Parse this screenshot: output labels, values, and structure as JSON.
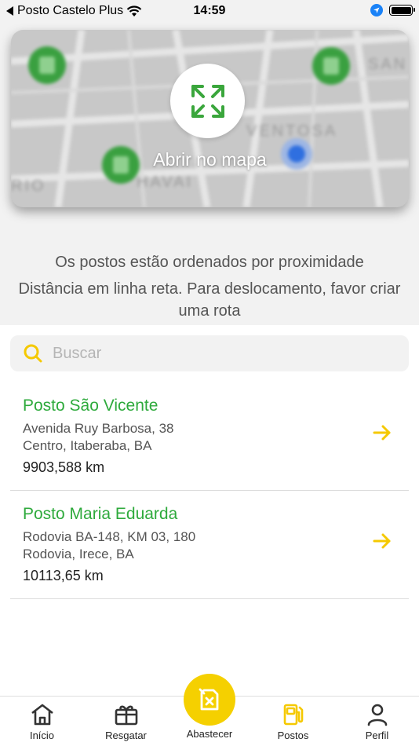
{
  "status_bar": {
    "carrier": "Posto Castelo Plus",
    "time": "14:59"
  },
  "map": {
    "open_label": "Abrir no mapa"
  },
  "info": {
    "line1": "Os postos estão ordenados por proximidade",
    "line2": "Distância em linha reta. Para deslocamento, favor criar uma rota"
  },
  "search": {
    "placeholder": "Buscar",
    "value": ""
  },
  "stations": [
    {
      "name": "Posto São Vicente",
      "address_line1": "Avenida Ruy Barbosa, 38",
      "address_line2": "Centro, Itaberaba, BA",
      "distance": "9903,588 km"
    },
    {
      "name": "Posto Maria Eduarda",
      "address_line1": "Rodovia BA-148, KM 03, 180",
      "address_line2": "Rodovia, Irece, BA",
      "distance": "10113,65 km"
    }
  ],
  "tabs": {
    "inicio": "Início",
    "resgatar": "Resgatar",
    "abastecer": "Abastecer",
    "postos": "Postos",
    "perfil": "Perfil"
  },
  "colors": {
    "accent_yellow": "#f5d000",
    "station_green": "#2eaa3c"
  }
}
